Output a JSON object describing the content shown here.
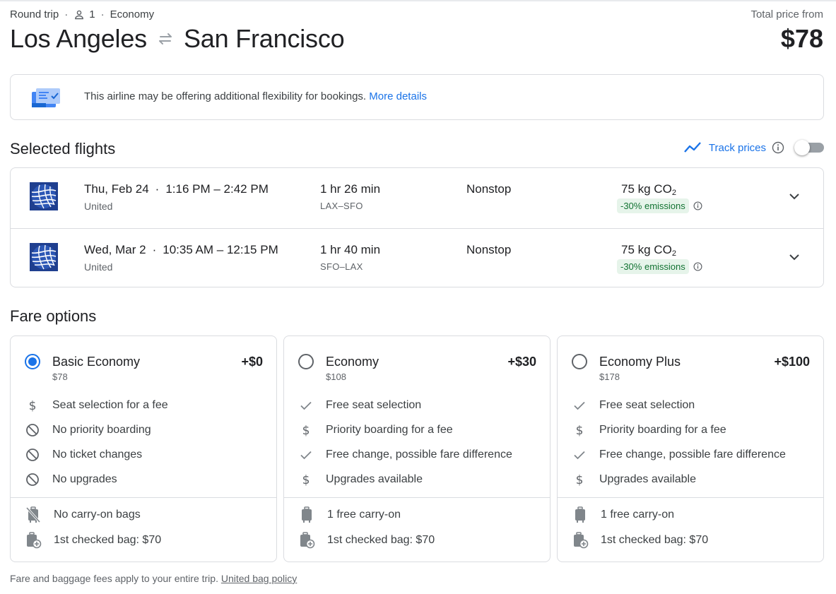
{
  "header": {
    "trip_type": "Round trip",
    "passengers": "1",
    "cabin": "Economy",
    "origin": "Los Angeles",
    "destination": "San Francisco",
    "total_label": "Total price from",
    "total_price": "$78"
  },
  "banner": {
    "text": "This airline may be offering additional flexibility for bookings.",
    "link": "More details"
  },
  "selected_flights": {
    "title": "Selected flights",
    "track_label": "Track prices",
    "track_enabled": false,
    "flights": [
      {
        "date": "Thu, Feb 24",
        "time_range": "1:16 PM – 2:42 PM",
        "airline": "United",
        "duration": "1 hr 26 min",
        "airports": "LAX–SFO",
        "stops": "Nonstop",
        "co2": "75 kg CO",
        "co2_sub": "2",
        "emissions": "-30% emissions"
      },
      {
        "date": "Wed, Mar 2",
        "time_range": "10:35 AM – 12:15 PM",
        "airline": "United",
        "duration": "1 hr 40 min",
        "airports": "SFO–LAX",
        "stops": "Nonstop",
        "co2": "75 kg CO",
        "co2_sub": "2",
        "emissions": "-30% emissions"
      }
    ]
  },
  "fare_options": {
    "title": "Fare options",
    "fares": [
      {
        "name": "Basic Economy",
        "price": "$78",
        "delta": "+$0",
        "selected": true,
        "features": [
          {
            "icon": "dollar-icon",
            "label": "Seat selection for a fee"
          },
          {
            "icon": "block-icon",
            "label": "No priority boarding"
          },
          {
            "icon": "block-icon",
            "label": "No ticket changes"
          },
          {
            "icon": "block-icon",
            "label": "No upgrades"
          }
        ],
        "bags": [
          {
            "icon": "no-carry-on-icon",
            "label": "No carry-on bags"
          },
          {
            "icon": "checked-bag-icon",
            "label": "1st checked bag: $70"
          }
        ]
      },
      {
        "name": "Economy",
        "price": "$108",
        "delta": "+$30",
        "selected": false,
        "features": [
          {
            "icon": "check-icon",
            "label": "Free seat selection"
          },
          {
            "icon": "dollar-icon",
            "label": "Priority boarding for a fee"
          },
          {
            "icon": "check-icon",
            "label": "Free change, possible fare difference"
          },
          {
            "icon": "dollar-icon",
            "label": "Upgrades available"
          }
        ],
        "bags": [
          {
            "icon": "carry-on-icon",
            "label": "1 free carry-on"
          },
          {
            "icon": "checked-bag-icon",
            "label": "1st checked bag: $70"
          }
        ]
      },
      {
        "name": "Economy Plus",
        "price": "$178",
        "delta": "+$100",
        "selected": false,
        "features": [
          {
            "icon": "check-icon",
            "label": "Free seat selection"
          },
          {
            "icon": "dollar-icon",
            "label": "Priority boarding for a fee"
          },
          {
            "icon": "check-icon",
            "label": "Free change, possible fare difference"
          },
          {
            "icon": "dollar-icon",
            "label": "Upgrades available"
          }
        ],
        "bags": [
          {
            "icon": "carry-on-icon",
            "label": "1 free carry-on"
          },
          {
            "icon": "checked-bag-icon",
            "label": "1st checked bag: $70"
          }
        ]
      }
    ]
  },
  "footer": {
    "text": "Fare and baggage fees apply to your entire trip.",
    "link": "United bag policy"
  },
  "colors": {
    "accent": "#1a73e8",
    "emissions_bg": "#e6f4ea",
    "emissions_text": "#137333",
    "border": "#dadce0"
  }
}
